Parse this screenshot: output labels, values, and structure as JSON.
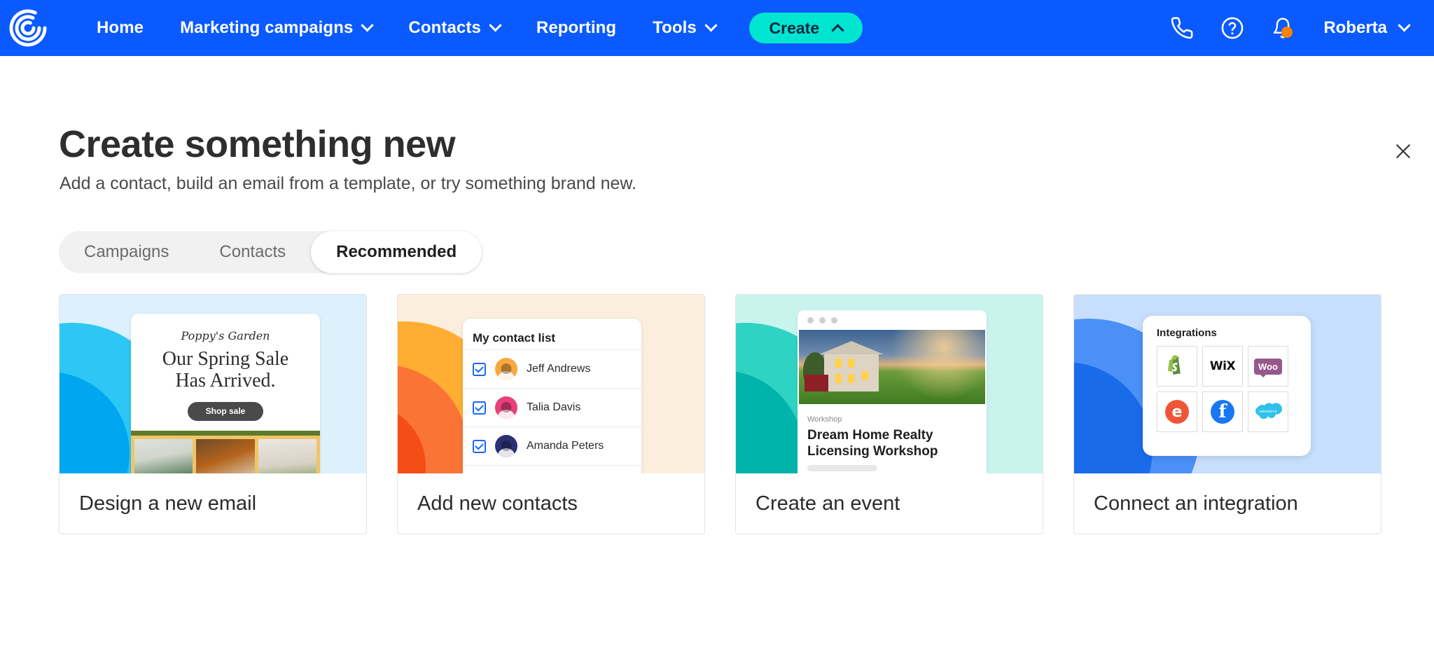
{
  "header": {
    "logo_icon": "constant-contact-logo",
    "brand_blue": "#0a5aff",
    "nav": [
      {
        "label": "Home",
        "has_caret": false
      },
      {
        "label": "Marketing campaigns",
        "has_caret": true
      },
      {
        "label": "Contacts",
        "has_caret": true
      },
      {
        "label": "Reporting",
        "has_caret": false
      },
      {
        "label": "Tools",
        "has_caret": true
      }
    ],
    "create_button": {
      "label": "Create",
      "caret": "up",
      "color": "#00e5d0"
    },
    "icons": [
      {
        "name": "phone-icon"
      },
      {
        "name": "help-icon"
      },
      {
        "name": "notifications-bell-icon",
        "badge_color": "#ff8200"
      }
    ],
    "user": {
      "name": "Roberta",
      "caret": "down"
    }
  },
  "close_label": "close-icon",
  "main": {
    "title": "Create something new",
    "subtitle": "Add a contact, build an email from a template, or try something brand new.",
    "tabs": [
      {
        "label": "Campaigns",
        "active": false
      },
      {
        "label": "Contacts",
        "active": false
      },
      {
        "label": "Recommended",
        "active": true
      }
    ],
    "cards": [
      {
        "label": "Design a new email",
        "art": {
          "brand": "Poppy's Garden",
          "headline_line1": "Our Spring Sale",
          "headline_line2": "Has Arrived.",
          "button": "Shop sale"
        }
      },
      {
        "label": "Add new contacts",
        "art": {
          "list_title": "My contact list",
          "contacts": [
            {
              "name": "Jeff Andrews",
              "checked": true
            },
            {
              "name": "Talia Davis",
              "checked": true
            },
            {
              "name": "Amanda Peters",
              "checked": true
            }
          ]
        }
      },
      {
        "label": "Create an event",
        "art": {
          "kicker": "Workshop",
          "title_line1": "Dream Home Realty",
          "title_line2": "Licensing Workshop"
        }
      },
      {
        "label": "Connect an integration",
        "art": {
          "panel_title": "Integrations",
          "logos": [
            "shopify-logo",
            "wix-logo",
            "woocommerce-logo",
            "eventbrite-logo",
            "facebook-logo",
            "salesforce-logo"
          ],
          "wix_text": "WiX",
          "woo_text": "Woo",
          "eventbrite_text": "e",
          "facebook_text": "f",
          "salesforce_text": "salesforce"
        }
      }
    ]
  }
}
